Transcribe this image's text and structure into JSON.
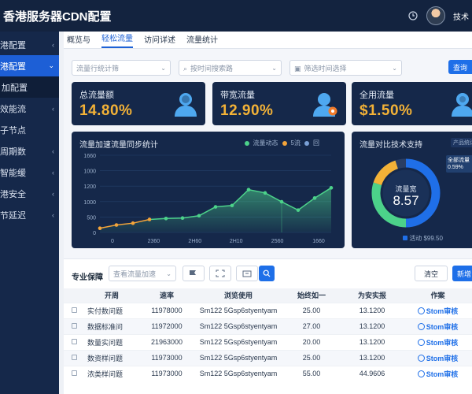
{
  "app": {
    "title": "香港服务器CDN配置",
    "user_name": "技术"
  },
  "colors": {
    "header_bg": "#13233f",
    "sidebar_bg": "#15284a",
    "accent": "#1e6fe8",
    "kpi_value": "#f3b237",
    "line": "#4cd28a",
    "line_orange": "#f3a43a"
  },
  "sidebar": {
    "items": [
      {
        "label": "港配置",
        "chevron": "‹",
        "state": "normal"
      },
      {
        "label": "港配置",
        "chevron": "⌄",
        "state": "active"
      },
      {
        "label": "加配置",
        "chevron": "",
        "state": "sub"
      },
      {
        "label": "效能流",
        "chevron": "‹",
        "state": "normal"
      },
      {
        "label": "子节点",
        "chevron": "",
        "state": "normal"
      },
      {
        "label": "周期数",
        "chevron": "‹",
        "state": "normal"
      },
      {
        "label": "智能缓",
        "chevron": "‹",
        "state": "normal"
      },
      {
        "label": "港安全",
        "chevron": "‹",
        "state": "normal"
      },
      {
        "label": "节延迟",
        "chevron": "‹",
        "state": "normal"
      }
    ]
  },
  "tabs": [
    {
      "label": "概览与",
      "active": false
    },
    {
      "label": "轻松流量",
      "active": true
    },
    {
      "label": "访问详述",
      "active": false
    },
    {
      "label": "流量统计",
      "active": false
    }
  ],
  "filters": [
    {
      "placeholder": "流量行统计筛",
      "icon": "",
      "dropdown": "⌄"
    },
    {
      "placeholder": "按时间搜索路",
      "icon": "⌕",
      "dropdown": "⌄"
    },
    {
      "placeholder": "筛选时间选择",
      "icon": "▣",
      "dropdown": "⌄"
    }
  ],
  "query_button": "查询",
  "kpis": [
    {
      "label": "总流量额",
      "value": "14.80%"
    },
    {
      "label": "带宽流量",
      "value": "12.90%"
    },
    {
      "label": "全用流量",
      "value": "$1.50%"
    }
  ],
  "line_panel": {
    "title": "流量加速流量同步统计",
    "legend": [
      {
        "label": "流量动态",
        "color": "#4cd28a"
      },
      {
        "label": "5流",
        "color": "#f3a43a"
      },
      {
        "label": "回",
        "color": "#7aa0d6"
      }
    ]
  },
  "donut_panel": {
    "title": "流量对比技术支持",
    "badge": "产品统计",
    "center_label": "流量宽",
    "center_value": "8.57",
    "annotation": "全部流量 0.59%",
    "footer": "活动 $99.50"
  },
  "chart_data": [
    {
      "type": "line",
      "title": "流量加速流量同步统计",
      "x_ticks": [
        "0",
        "2360",
        "2H60",
        "2H10",
        "2560",
        "1660"
      ],
      "y_ticks": [
        "1660",
        "1000",
        "1200",
        "1000",
        "500",
        "0"
      ],
      "ylim": [
        0,
        1660
      ],
      "series": [
        {
          "name": "流量动态",
          "color": "#4cd28a",
          "x": [
            0,
            1,
            2,
            3,
            4,
            5,
            6,
            7,
            8,
            9,
            10,
            11,
            12,
            13,
            14
          ],
          "y": [
            90,
            160,
            200,
            280,
            300,
            310,
            360,
            550,
            580,
            920,
            850,
            660,
            480,
            740,
            960
          ]
        }
      ],
      "highlight_first_points": 4,
      "highlight_color": "#f3a43a",
      "grid": true
    },
    {
      "type": "pie",
      "title": "流量对比技术支持",
      "slices": [
        {
          "label": "流量宽",
          "value": 50,
          "color": "#1f6fe8"
        },
        {
          "label": "全部流量",
          "value": 30,
          "color": "#4cd28a"
        },
        {
          "label": "其他",
          "value": 15,
          "color": "#f3b237"
        },
        {
          "label": "剩余",
          "value": 5,
          "color": "#2a3e63"
        }
      ]
    }
  ],
  "table": {
    "title": "专业保障",
    "search_placeholder": "查看流量加速",
    "reset_button": "清空",
    "add_button": "新增",
    "columns": [
      "",
      "开周",
      "速率",
      "浏览使用",
      "始终如一",
      "为安实报",
      "作案"
    ],
    "rows": [
      {
        "name": "实付数问题",
        "rate": "11978000",
        "usage": "Sm122 5Gsp6styentyam",
        "value1": "25.00",
        "value2": "13.1200",
        "action": "Stom审核"
      },
      {
        "name": "数据标准问",
        "rate": "11972000",
        "usage": "Sm122 5Gsp6styentyam",
        "value1": "27.00",
        "value2": "13.1200",
        "action": "Stom审核"
      },
      {
        "name": "数量实问题",
        "rate": "21963000",
        "usage": "Sm122 5Gsp6styentyam",
        "value1": "20.00",
        "value2": "13.1200",
        "action": "Stom审核"
      },
      {
        "name": "数资样问题",
        "rate": "11973000",
        "usage": "Sm122 5Gsp6styentyam",
        "value1": "25.00",
        "value2": "13.1200",
        "action": "Stom审核"
      },
      {
        "name": "浓类样问题",
        "rate": "11973000",
        "usage": "Sm122 5Gsp6styentyam",
        "value1": "55.00",
        "value2": "44.9606",
        "action": "Stom审核"
      }
    ]
  }
}
